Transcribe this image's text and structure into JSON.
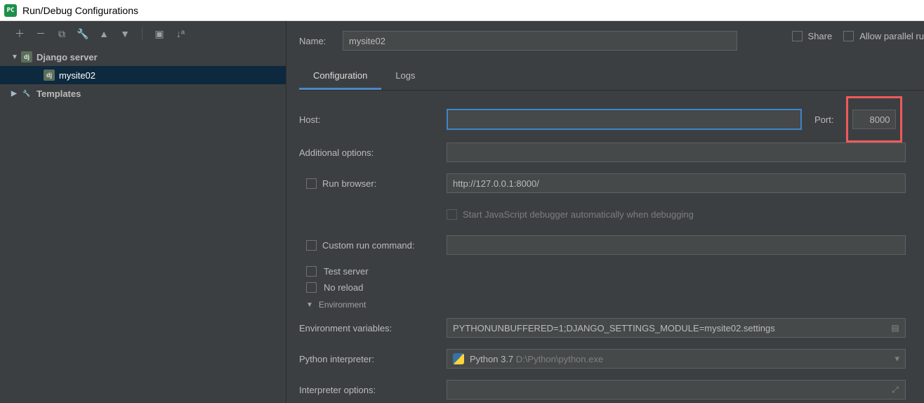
{
  "title": "Run/Debug Configurations",
  "sidebar": {
    "group1": {
      "label": "Django server"
    },
    "item1": {
      "label": "mysite02"
    },
    "group2": {
      "label": "Templates"
    }
  },
  "header": {
    "name_label": "Name:",
    "name_value": "mysite02",
    "share_label": "Share",
    "parallel_label": "Allow parallel ru"
  },
  "tabs": {
    "config": "Configuration",
    "logs": "Logs"
  },
  "form": {
    "host_label": "Host:",
    "host_value": "",
    "port_label": "Port:",
    "port_value": "8000",
    "addl_label": "Additional options:",
    "addl_value": "",
    "runbrowser_label": "Run browser:",
    "runbrowser_value": "http://127.0.0.1:8000/",
    "jsdbg_label": "Start JavaScript debugger automatically when debugging",
    "custom_label": "Custom run command:",
    "testserver_label": "Test server",
    "noreload_label": "No reload",
    "env_header": "Environment",
    "envvars_label": "Environment variables:",
    "envvars_value": "PYTHONUNBUFFERED=1;DJANGO_SETTINGS_MODULE=mysite02.settings",
    "interp_label": "Python interpreter:",
    "interp_name": "Python 3.7",
    "interp_path": "D:\\Python\\python.exe",
    "interpopts_label": "Interpreter options:"
  }
}
